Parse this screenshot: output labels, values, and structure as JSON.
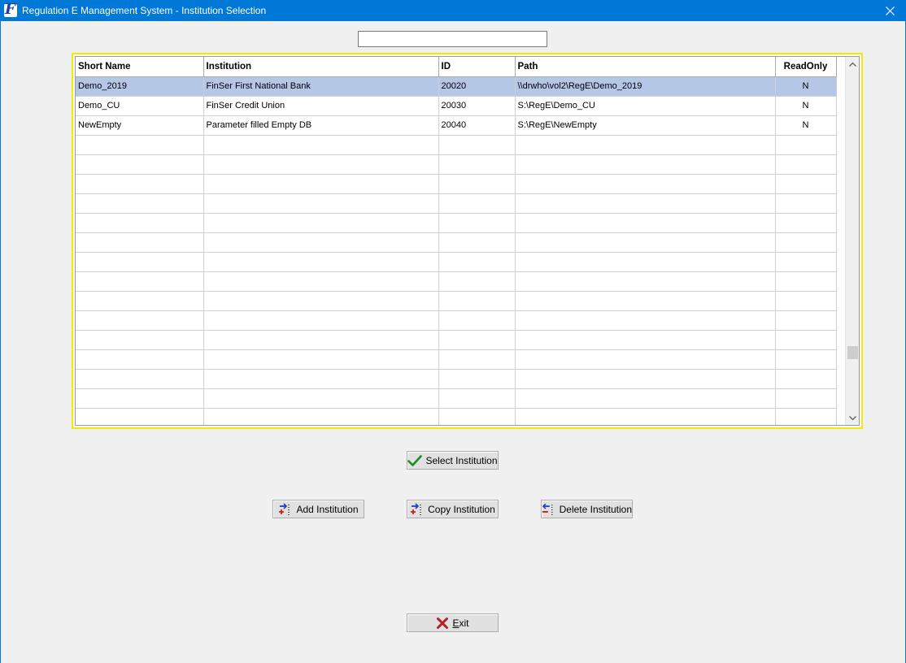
{
  "window": {
    "title": "Regulation E Management System - Institution Selection"
  },
  "search": {
    "value": "",
    "placeholder": ""
  },
  "grid": {
    "columns": [
      "Short Name",
      "Institution",
      "ID",
      "Path",
      "ReadOnly"
    ],
    "rows": [
      {
        "short_name": "Demo_2019",
        "institution": "FinSer First National Bank",
        "id": "20020",
        "path": "\\\\drwho\\vol2\\RegE\\Demo_2019",
        "readonly": "N"
      },
      {
        "short_name": "Demo_CU",
        "institution": "FinSer Credit Union",
        "id": "20030",
        "path": "S:\\RegE\\Demo_CU",
        "readonly": "N"
      },
      {
        "short_name": "NewEmpty",
        "institution": "Parameter filled Empty DB",
        "id": "20040",
        "path": "S:\\RegE\\NewEmpty",
        "readonly": "N"
      }
    ],
    "selected_row": 0
  },
  "buttons": {
    "select": "Select Institution",
    "add": "Add Institution",
    "copy": "Copy Institution",
    "delete": "Delete Institution",
    "exit_prefix": "",
    "exit_underlined": "E",
    "exit_rest": "xit"
  },
  "colors": {
    "titlebar": "#0078d7",
    "selected_row": "#b4c7e7",
    "grid_highlight": "#f2ea00",
    "check": "#1f8a1f",
    "exit_x": "#b22222"
  },
  "icons": {
    "app": "app-logo-icon",
    "close": "close-icon",
    "select": "checkmark-icon",
    "add": "add-record-icon",
    "copy": "copy-record-icon",
    "delete": "delete-record-icon",
    "exit": "red-x-icon",
    "scroll_up": "chevron-up-icon",
    "scroll_down": "chevron-down-icon"
  }
}
